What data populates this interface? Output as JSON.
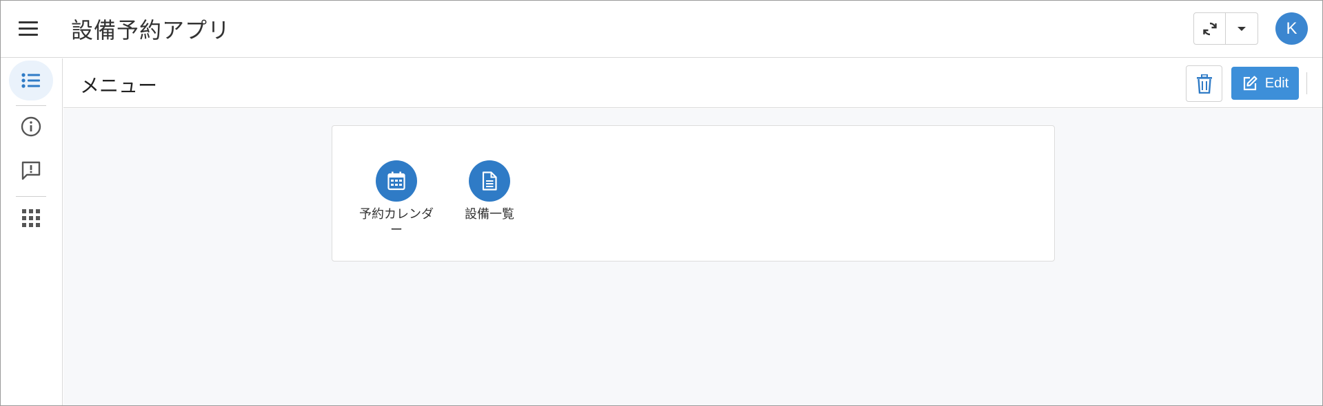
{
  "app": {
    "title": "設備予約アプリ",
    "user_initial": "K"
  },
  "colors": {
    "accent": "#3b86d0",
    "tile": "#2f7bc6",
    "edit_button": "#3d8fd9",
    "content_bg": "#f7f8fa"
  },
  "rail": {
    "items": [
      {
        "icon": "list-icon",
        "active": true
      },
      {
        "icon": "info-icon",
        "active": false
      },
      {
        "icon": "feedback-icon",
        "active": false
      },
      {
        "icon": "apps-grid-icon",
        "active": false
      }
    ]
  },
  "page": {
    "title": "メニュー",
    "edit_label": "Edit"
  },
  "menu": {
    "items": [
      {
        "label": "予約カレンダー",
        "icon": "calendar-icon"
      },
      {
        "label": "設備一覧",
        "icon": "document-icon"
      }
    ]
  }
}
